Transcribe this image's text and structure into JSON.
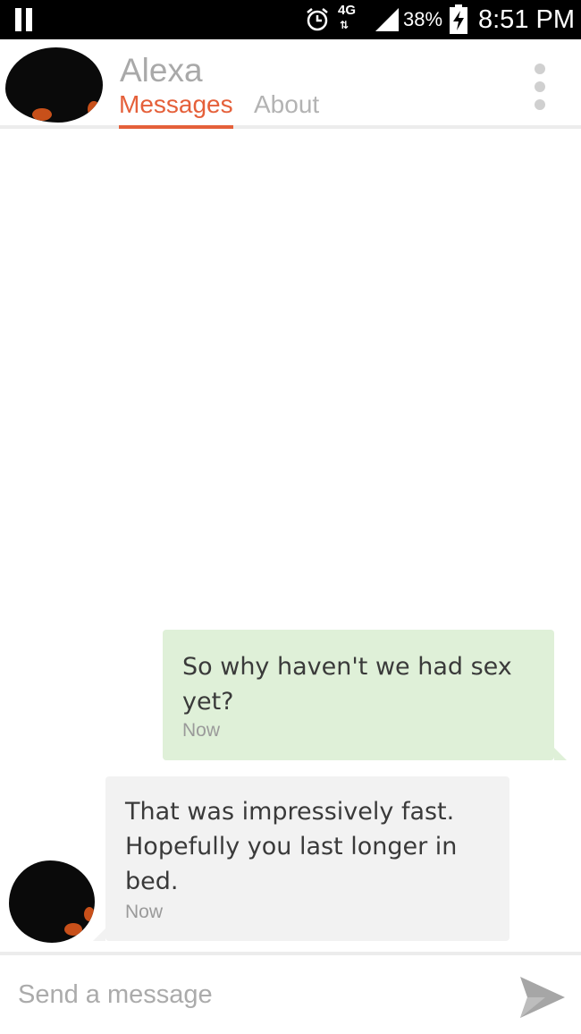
{
  "status_bar": {
    "network_label": "4G",
    "network_sub": "⇅",
    "battery_percent": "38%",
    "time": "8:51 PM",
    "icons": [
      "pause-icon",
      "alarm-icon",
      "signal-icon",
      "battery-charging-icon"
    ]
  },
  "header": {
    "contact_name": "Alexa",
    "tabs": [
      {
        "label": "Messages",
        "active": true
      },
      {
        "label": "About",
        "active": false
      }
    ],
    "accent_color": "#e5603a",
    "menu_icon": "more-vertical-icon"
  },
  "messages": [
    {
      "direction": "outgoing",
      "text": "So why haven't we had sex yet?",
      "time": "Now",
      "bubble_color": "#dff0d8"
    },
    {
      "direction": "incoming",
      "text": "That was impressively fast. Hopefully you last longer in bed.",
      "time": "Now",
      "bubble_color": "#f2f2f2"
    }
  ],
  "composer": {
    "placeholder": "Send a message",
    "value": "",
    "send_icon": "send-icon"
  }
}
